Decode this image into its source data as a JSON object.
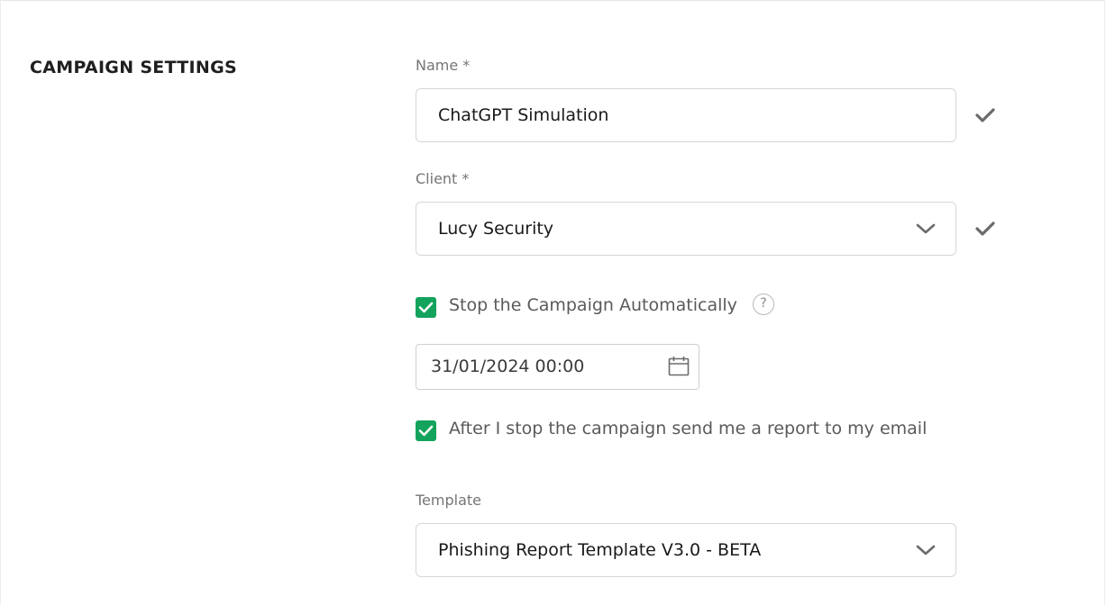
{
  "section": {
    "title": "CAMPAIGN SETTINGS"
  },
  "name_field": {
    "label": "Name *",
    "value": "ChatGPT Simulation"
  },
  "client_field": {
    "label": "Client *",
    "value": "Lucy Security"
  },
  "stop_automatically": {
    "label": "Stop the Campaign Automatically",
    "checked": true,
    "help": "?"
  },
  "stop_date": {
    "value": "31/01/2024 00:00"
  },
  "send_report": {
    "label": "After I stop the campaign send me a report to my email",
    "checked": true
  },
  "template_field": {
    "label": "Template",
    "value": "Phishing Report Template V3.0 - BETA"
  },
  "colors": {
    "checkbox": "#13a35c",
    "valid_check": "#6b6b6b",
    "border": "#d6d6d6"
  },
  "icons": [
    "checkmark-icon",
    "chevron-down-icon",
    "help-icon",
    "calendar-icon"
  ]
}
